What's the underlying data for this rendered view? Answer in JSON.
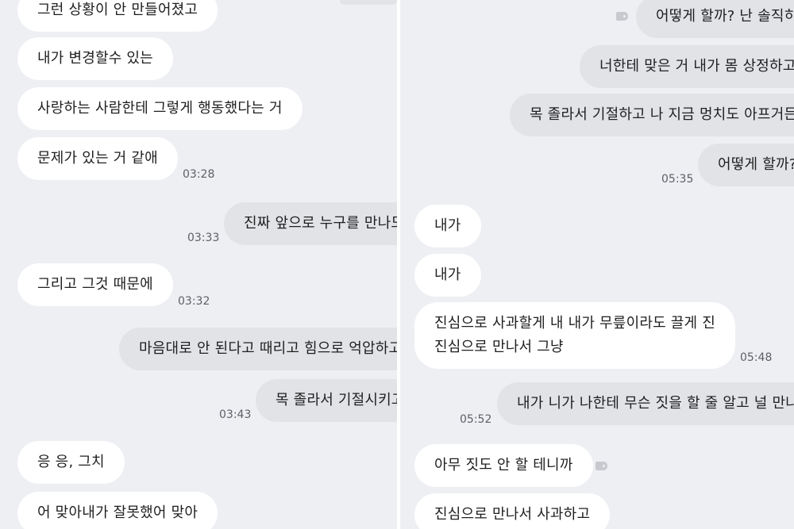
{
  "left": {
    "messages": [
      {
        "text": "그런 상황이 안 만들어졌고"
      },
      {
        "text": "내가 변경할수 있는"
      },
      {
        "text": "사랑하는 사람한테 그렇게 행동했다는 거"
      },
      {
        "text": "문제가 있는 거 같애",
        "time": "03:28"
      },
      {
        "text": "진짜 앞으로 누구를 만나도",
        "time": "03:33"
      },
      {
        "text": "그리고 그것 때문에",
        "time": "03:32"
      },
      {
        "text": "마음대로 안 된다고 때리고 힘으로 억압하고"
      },
      {
        "text": "목 졸라서 기절시키고",
        "time": "03:43"
      },
      {
        "text": "응 응, 그치"
      },
      {
        "text": "어 맞아내가 잘못했어 맞아"
      }
    ]
  },
  "right": {
    "messages": [
      {
        "text": "어떻게 할까? 난 솔직히"
      },
      {
        "text": "너한테 맞은 거 내가 몸 상정하고"
      },
      {
        "text": "목 졸라서 기절하고 나 지금 멍치도 아프거든"
      },
      {
        "text": "어떻게 할까?",
        "time": "05:35"
      },
      {
        "text": "내가"
      },
      {
        "text": "내가"
      },
      {
        "lines": [
          "진심으로 사과할게 내 내가 무릎이라도 끌게 진",
          "진심으로 만나서 그냥"
        ],
        "time": "05:48"
      },
      {
        "text": "내가 니가 나한테 무슨 짓을 할 줄 알고 널 만나",
        "time": "05:52"
      },
      {
        "text": "아무 짓도 안 할 테니까"
      },
      {
        "text": "진심으로 만나서 사과하고"
      }
    ]
  }
}
